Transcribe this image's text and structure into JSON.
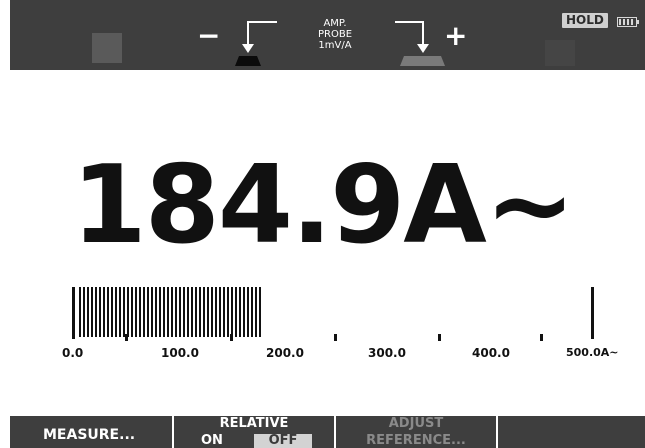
{
  "top": {
    "probe_line1": "AMP.",
    "probe_line2": "PROBE",
    "probe_line3": "1mV/A",
    "minus": "−",
    "plus": "+",
    "hold": "HOLD",
    "icons": [
      "probe-minus-icon",
      "probe-plus-icon",
      "ghost-plug-icon",
      "battery-icon"
    ]
  },
  "reading": {
    "value": "184.9",
    "unit": "A~"
  },
  "bargraph": {
    "min": 0.0,
    "max": 500.0,
    "level": 184.9,
    "labels": [
      "0.0",
      "100.0",
      "200.0",
      "300.0",
      "400.0",
      "500.0A~"
    ]
  },
  "softkeys": {
    "measure": "MEASURE...",
    "relative_title": "RELATIVE",
    "relative_on": "ON",
    "relative_off": "OFF",
    "adjust_line1": "ADJUST",
    "adjust_line2": "REFERENCE..."
  },
  "colors": {
    "bar_bg": "#3e3e3e",
    "display_bg": "#ffffff",
    "disabled_text": "#8a8a8a"
  }
}
